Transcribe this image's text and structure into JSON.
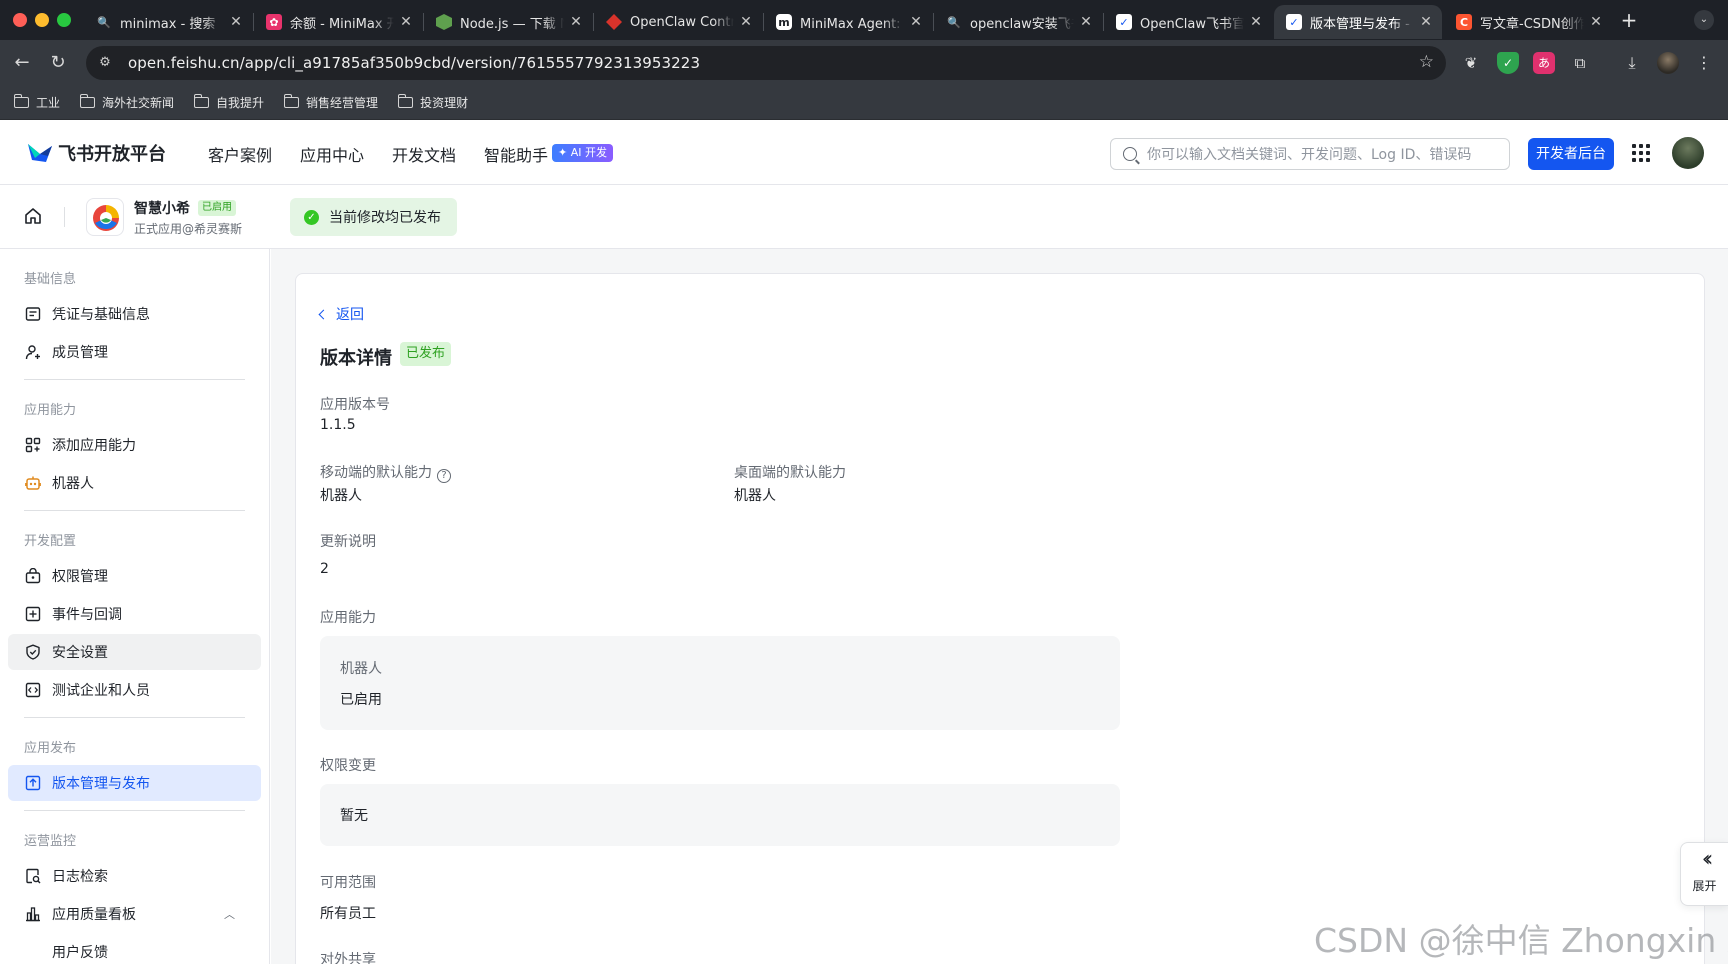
{
  "browser": {
    "tabs": [
      {
        "title": "minimax - 搜索",
        "icon": "search-icon",
        "color": "#3b82f6"
      },
      {
        "title": "余额 - MiniMax 开",
        "icon": "minimax-icon",
        "color": "#e8336c"
      },
      {
        "title": "Node.js — 下载 N",
        "icon": "nodejs-icon",
        "color": "#5fa04e"
      },
      {
        "title": "OpenClaw Contro",
        "icon": "openclaw-icon",
        "color": "#d8332b"
      },
      {
        "title": "MiniMax Agent: 旨",
        "icon": "minimax-agent-icon",
        "color": "#ffffff"
      },
      {
        "title": "openclaw安装飞书",
        "icon": "search-icon",
        "color": "#3b82f6"
      },
      {
        "title": "OpenClaw飞书官",
        "icon": "feishu-icon",
        "color": "#1456f0"
      },
      {
        "title": "版本管理与发布 -",
        "icon": "feishu-icon",
        "color": "#1456f0",
        "active": true
      },
      {
        "title": "写文章-CSDN创作",
        "icon": "csdn-icon",
        "color": "#fc5531"
      }
    ],
    "url": "open.feishu.cn/app/cli_a91785af350b9cbd/version/7615557792313953223",
    "bookmarks": [
      "工业",
      "海外社交新闻",
      "自我提升",
      "销售经营管理",
      "投资理财"
    ]
  },
  "header": {
    "brand": "飞书开放平台",
    "nav": [
      "客户案例",
      "应用中心",
      "开发文档",
      "智能助手"
    ],
    "ai_badge": "✦ AI 开发",
    "search_placeholder": "你可以输入文档关键词、开发问题、Log ID、错误码",
    "dev_button": "开发者后台"
  },
  "app": {
    "name": "智慧小希",
    "badge": "已启用",
    "subtitle": "正式应用@希灵赛斯",
    "publish_status": "当前修改均已发布"
  },
  "sidebar": {
    "groups": [
      {
        "title": "基础信息",
        "items": [
          {
            "label": "凭证与基础信息",
            "icon": "credential-icon"
          },
          {
            "label": "成员管理",
            "icon": "member-icon"
          }
        ]
      },
      {
        "title": "应用能力",
        "items": [
          {
            "label": "添加应用能力",
            "icon": "grid-add-icon"
          },
          {
            "label": "机器人",
            "icon": "robot-icon"
          }
        ]
      },
      {
        "title": "开发配置",
        "items": [
          {
            "label": "权限管理",
            "icon": "lock-icon"
          },
          {
            "label": "事件与回调",
            "icon": "event-icon"
          },
          {
            "label": "安全设置",
            "icon": "shield-icon"
          },
          {
            "label": "测试企业和人员",
            "icon": "code-icon"
          }
        ]
      },
      {
        "title": "应用发布",
        "items": [
          {
            "label": "版本管理与发布",
            "icon": "upload-icon"
          }
        ]
      },
      {
        "title": "运营监控",
        "items": [
          {
            "label": "日志检索",
            "icon": "log-search-icon"
          },
          {
            "label": "应用质量看板",
            "icon": "bar-chart-icon"
          },
          {
            "label": "用户反馈",
            "icon": ""
          }
        ]
      }
    ]
  },
  "version": {
    "back": "返回",
    "title": "版本详情",
    "status": "已发布",
    "version_label": "应用版本号",
    "version_value": "1.1.5",
    "mobile_label": "移动端的默认能力",
    "mobile_value": "机器人",
    "desktop_label": "桌面端的默认能力",
    "desktop_value": "机器人",
    "notes_label": "更新说明",
    "notes_value": "2",
    "capability_label": "应用能力",
    "capability_name": "机器人",
    "capability_status": "已启用",
    "permission_label": "权限变更",
    "permission_value": "暂无",
    "scope_label": "可用范围",
    "scope_value": "所有员工",
    "share_label": "对外共享"
  },
  "expand": "展开",
  "watermark": "CSDN @徐中信 Zhongxin Xu"
}
